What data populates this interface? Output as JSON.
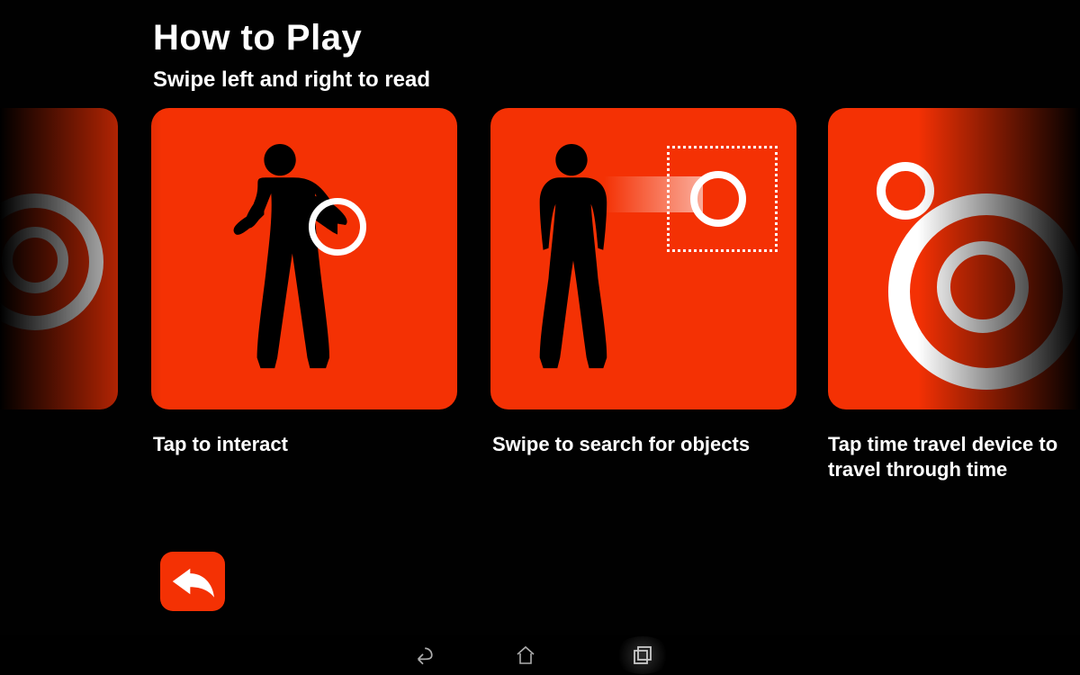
{
  "colors": {
    "accent": "#f43104",
    "bg": "#010101",
    "fg": "#ffffff"
  },
  "header": {
    "title": "How to Play",
    "subtitle": "Swipe left and right to read"
  },
  "cards": [
    {
      "caption": ""
    },
    {
      "caption": "Tap to interact"
    },
    {
      "caption": "Swipe to search for objects"
    },
    {
      "caption": "Tap time travel device to travel through time"
    }
  ],
  "navbar": {
    "icons": [
      "back",
      "home",
      "recent"
    ],
    "active": "recent"
  },
  "back_button": {
    "label": "Back"
  }
}
